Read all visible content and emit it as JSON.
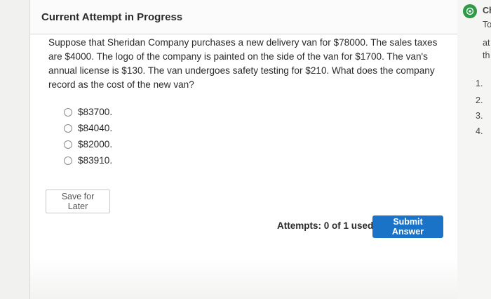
{
  "header": {
    "title": "Current Attempt in Progress"
  },
  "question": {
    "text": "Suppose that Sheridan Company purchases a new delivery van for $78000. The sales taxes are $4000. The logo of the company is painted on the side of the van for $1700. The van's annual license is $130. The van undergoes safety testing for $210. What does the company record as the cost of the new van?"
  },
  "options": [
    {
      "label": "$83700."
    },
    {
      "label": "$84040."
    },
    {
      "label": "$82000."
    },
    {
      "label": "$83910."
    }
  ],
  "buttons": {
    "save_for_later": "Save for Later",
    "submit_answer": "Submit Answer"
  },
  "attempts": {
    "text": "Attempts: 0 of 1 used"
  },
  "side_panel": {
    "icon": "chat-assistant-icon",
    "icon_color": "#2e9a46",
    "lines": [
      "Ch",
      "To",
      "at",
      "th"
    ],
    "list_numbers": [
      "1.",
      "2.",
      "3.",
      "4."
    ]
  },
  "colors": {
    "accent": "#1a73c6",
    "panel_background": "#ffffff",
    "page_background": "#f1f1f0"
  }
}
